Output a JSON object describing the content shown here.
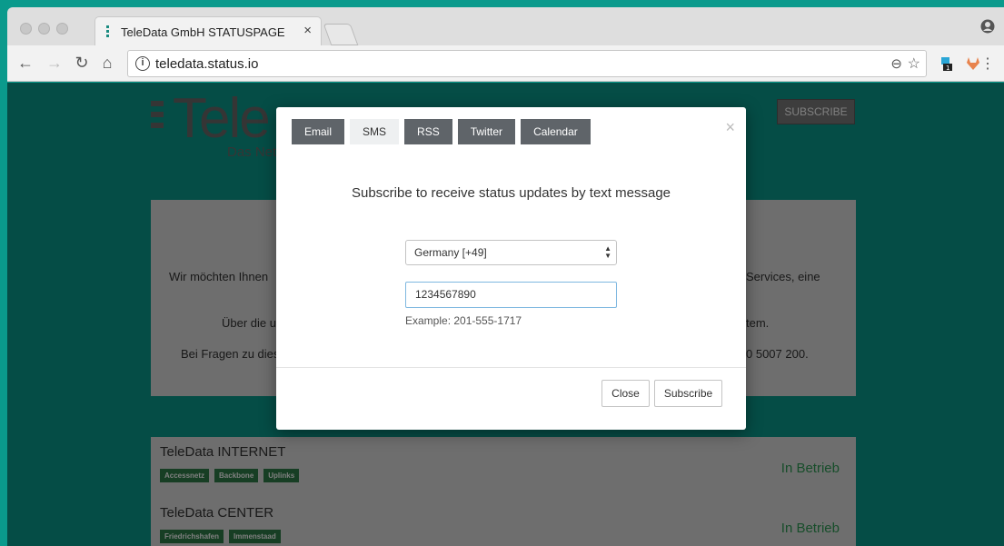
{
  "browser": {
    "tab_title": "TeleData GmbH STATUSPAGE",
    "tab_close": "×",
    "url": "teledata.status.io",
    "icons": [
      "back-icon",
      "forward-icon",
      "reload-icon",
      "home-icon",
      "info-icon",
      "zoom-icon",
      "star-icon",
      "extension-icon",
      "menu-icon"
    ]
  },
  "page": {
    "logo_text": "Tele",
    "logo_sub": "Das Net",
    "subscribe_label": "SUBSCRIBE",
    "info_lines": [
      {
        "left": "Wir möchten Ihnen",
        "right": "Services, eine"
      },
      {
        "left": "Über die u",
        "right": "tem."
      },
      {
        "left": "Bei Fragen zu dies",
        "right": "0 5007 200."
      }
    ],
    "components": [
      {
        "name": "TeleData INTERNET",
        "tags": [
          "Accessnetz",
          "Backbone",
          "Uplinks"
        ],
        "status": "In Betrieb"
      },
      {
        "name": "TeleData CENTER",
        "tags": [
          "Friedrichshafen",
          "Immenstaad"
        ],
        "status": "In Betrieb"
      }
    ]
  },
  "modal": {
    "tabs": [
      "Email",
      "SMS",
      "RSS",
      "Twitter",
      "Calendar"
    ],
    "active_tab": "SMS",
    "close_symbol": "×",
    "heading": "Subscribe to receive status updates by text message",
    "country_selected": "Germany [+49]",
    "phone_value": "1234567890",
    "phone_example": "Example: 201-555-1717",
    "close_label": "Close",
    "subscribe_label": "Subscribe"
  }
}
